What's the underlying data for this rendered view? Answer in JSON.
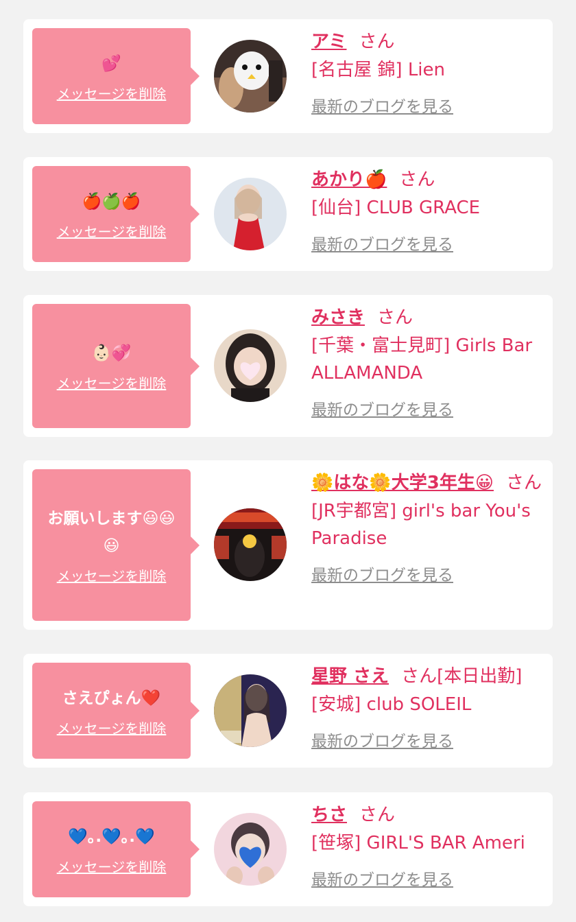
{
  "cards": [
    {
      "message": "💕",
      "delete_label": "メッセージを削除",
      "name": "アミ",
      "suffix": "さん",
      "shop": "[名古屋 錦] Lien",
      "blog_label": "最新のブログを見る",
      "avatar_icon": "girl-with-penguin-mask-avatar"
    },
    {
      "message": "🍎🍏🍎",
      "delete_label": "メッセージを削除",
      "name": "あかり🍎",
      "suffix": "さん",
      "shop": "[仙台] CLUB GRACE",
      "blog_label": "最新のブログを見る",
      "avatar_icon": "woman-red-dress-avatar"
    },
    {
      "message": "👶🏻💞",
      "delete_label": "メッセージを削除",
      "name": "みさき",
      "suffix": "さん",
      "shop": "[千葉・富士見町] Girls Bar ALLAMANDA",
      "blog_label": "最新のブログを見る",
      "avatar_icon": "girl-heart-face-avatar"
    },
    {
      "message": "お願いします😃😃😃",
      "delete_label": "メッセージを削除",
      "name": "🌼はな🌼大学3年生😀",
      "suffix": "さん",
      "shop": "[JR宇都宮] girl's bar You's Paradise",
      "blog_label": "最新のブログを見る",
      "avatar_icon": "bar-scene-avatar"
    },
    {
      "message": "さえぴょん❤️",
      "delete_label": "メッセージを削除",
      "name": "星野 さえ",
      "suffix": "さん[本日出勤]",
      "shop": "[安城] club SOLEIL",
      "blog_label": "最新のブログを見る",
      "avatar_icon": "woman-poster-avatar"
    },
    {
      "message": "💙｡.💙｡.💙",
      "delete_label": "メッセージを削除",
      "name": "ちさ",
      "suffix": "さん",
      "shop": "[笹塚] GIRL'S BAR Ameri",
      "blog_label": "最新のブログを見る",
      "avatar_icon": "girl-blue-heart-face-avatar"
    }
  ],
  "colors": {
    "page_bg": "#f2f2f2",
    "bubble_bg": "#f7909f",
    "accent_text": "#e0305f",
    "muted_link": "#8d8d8d"
  }
}
